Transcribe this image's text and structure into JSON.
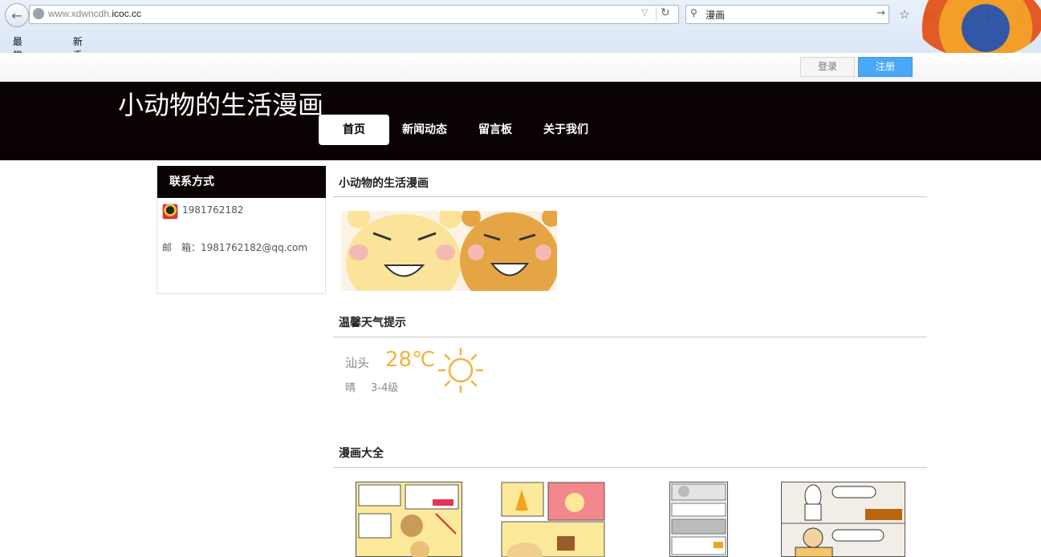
{
  "browser": {
    "url_path": "www.xdwncdh.",
    "url_host": "icoc.cc",
    "search_value": "漫画",
    "bookmarks": [
      "最常访问",
      "新手上路"
    ]
  },
  "auth": {
    "login": "登录",
    "register": "注册"
  },
  "site": {
    "title": "小动物的生活漫画",
    "nav": [
      "首页",
      "新闻动态",
      "留言板",
      "关于我们"
    ]
  },
  "sidebar": {
    "heading": "联系方式",
    "qq": "1981762182",
    "email": "邮　箱：1981762182@qq.com"
  },
  "sections": {
    "comic_intro": "小动物的生活漫画",
    "weather": "温馨天气提示",
    "comics": "漫画大全"
  },
  "weather": {
    "city": "汕头",
    "temp": "28℃",
    "desc": "晴",
    "wind": "3-4级"
  },
  "colors": {
    "header_bg": "#0a0106",
    "register_blue": "#49a8f8",
    "temp_orange": "#f3b33a"
  }
}
